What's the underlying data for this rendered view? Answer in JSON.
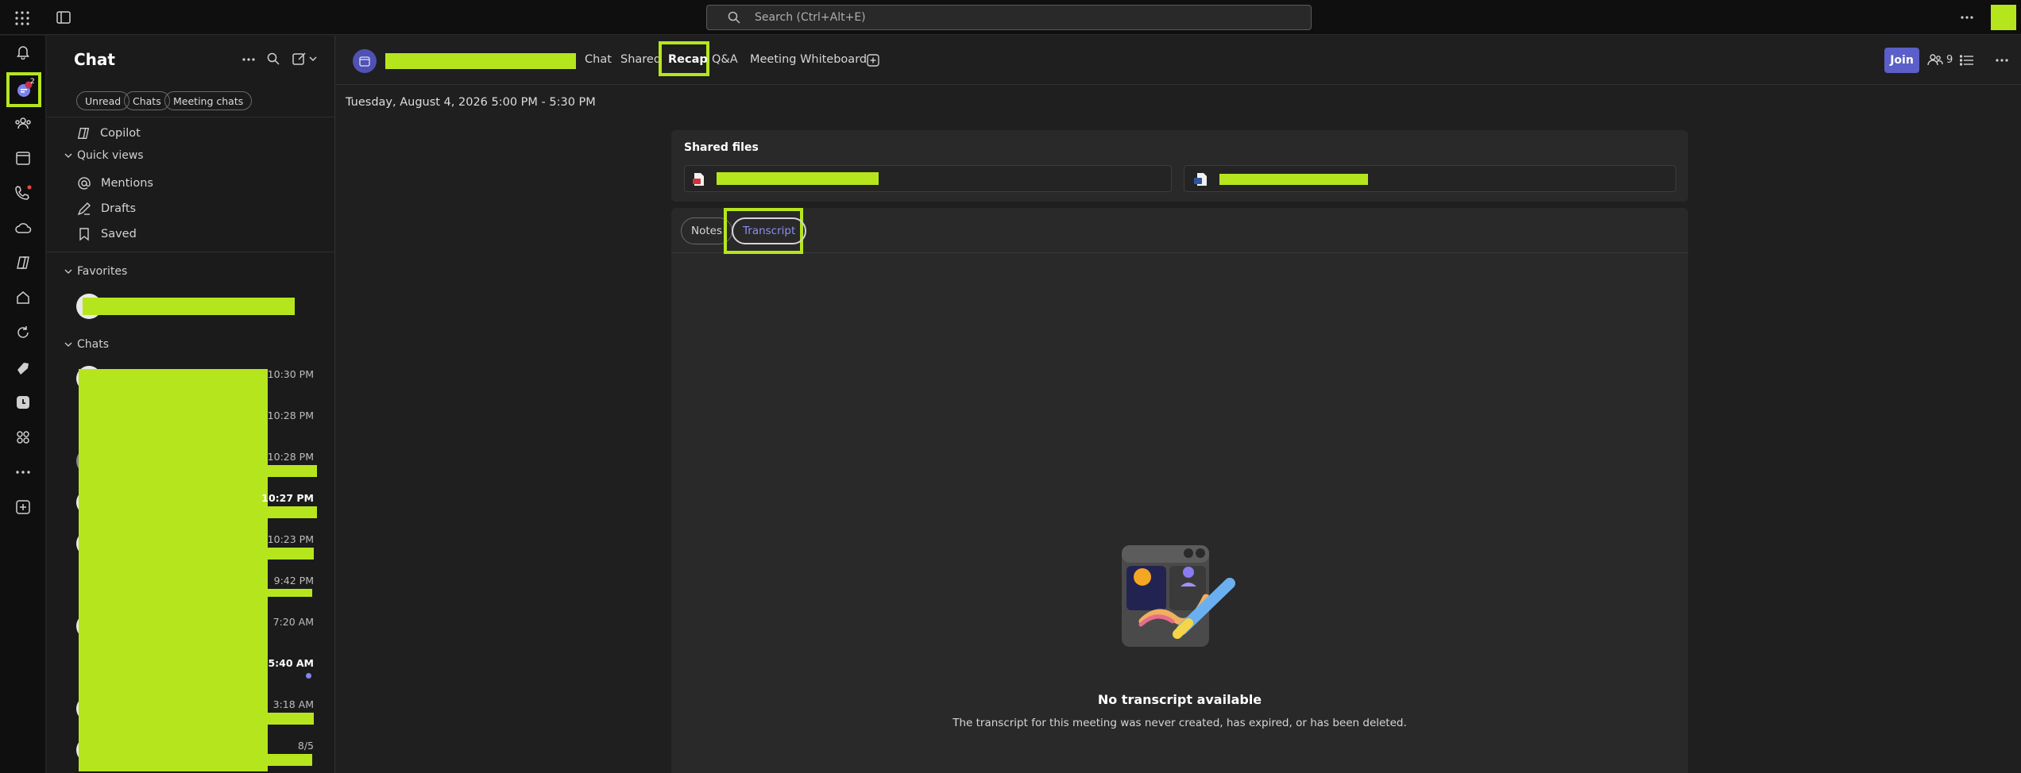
{
  "topbar": {
    "search_placeholder": "Search (Ctrl+Alt+E)"
  },
  "rail": {
    "items": [
      {
        "icon": "bell-icon"
      },
      {
        "icon": "chat-icon",
        "badge": "2"
      },
      {
        "icon": "teams-icon"
      },
      {
        "icon": "calendar-icon"
      },
      {
        "icon": "phone-icon"
      },
      {
        "icon": "cloud-icon"
      },
      {
        "icon": "copilot-icon"
      },
      {
        "icon": "home-icon"
      },
      {
        "icon": "refresh-icon"
      },
      {
        "icon": "rocket-icon"
      },
      {
        "icon": "clock-app-icon"
      },
      {
        "icon": "apps-icon"
      },
      {
        "icon": "more-icon"
      },
      {
        "icon": "add-app-icon"
      }
    ]
  },
  "chat_pane": {
    "title": "Chat",
    "filters": [
      "Unread",
      "Chats",
      "Meeting chats"
    ],
    "copilot": "Copilot",
    "quick_views_label": "Quick views",
    "quick_views": [
      "Mentions",
      "Drafts",
      "Saved"
    ],
    "favorites_label": "Favorites",
    "chats_label": "Chats",
    "chat_times": [
      {
        "time": "10:30 PM",
        "bold": false
      },
      {
        "time": "10:28 PM",
        "bold": false
      },
      {
        "time": "10:28 PM",
        "bold": false
      },
      {
        "time": "10:27 PM",
        "bold": true
      },
      {
        "time": "10:23 PM",
        "bold": false
      },
      {
        "time": "9:42 PM",
        "bold": false
      },
      {
        "time": "7:20 AM",
        "bold": false
      },
      {
        "time": "5:40 AM",
        "bold": true
      },
      {
        "time": "3:18 AM",
        "bold": false
      },
      {
        "time": "8/5",
        "bold": false
      }
    ]
  },
  "header": {
    "tabs": [
      "Chat",
      "Shared",
      "Recap",
      "Q&A",
      "Meeting Whiteboard"
    ],
    "active_tab": "Recap",
    "join_label": "Join",
    "participants_count": "9"
  },
  "meeting": {
    "date_line": "Tuesday, August 4, 2026 5:00 PM - 5:30 PM",
    "shared_files_label": "Shared files",
    "subtabs": [
      "Notes",
      "Transcript"
    ],
    "active_subtab": "Transcript",
    "empty_title": "No transcript available",
    "empty_desc": "The transcript for this meeting was never created, has expired, or has been deleted."
  },
  "colors": {
    "accent": "#5b5fc7",
    "redaction": "#b5e61d",
    "background": "#1f1f1f"
  }
}
